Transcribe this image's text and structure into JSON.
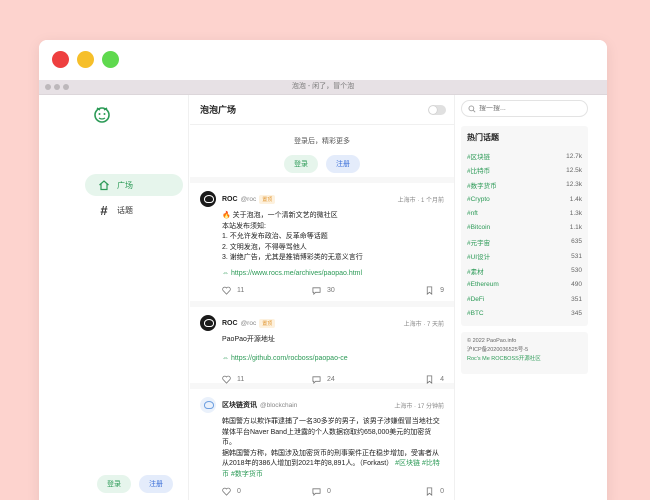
{
  "window": {
    "title": "泡泡 - 闲了，冒个泡"
  },
  "sidebar": {
    "nav": [
      {
        "label": "广场",
        "icon": "home-icon",
        "active": true
      },
      {
        "label": "话题",
        "icon": "hash-icon",
        "active": false
      }
    ],
    "login_label": "登录",
    "register_label": "注册"
  },
  "feed": {
    "title": "泡泡广场",
    "login_hint": "登录后，精彩更多",
    "login_label": "登录",
    "register_label": "注册",
    "posts": [
      {
        "author": "ROC",
        "handle": "@roc",
        "badge": "置顶",
        "meta": "上海市 · 1 个月前",
        "lines": [
          "🔥 关于泡泡，一个清新文艺的微社区",
          "本站发布须知:",
          "1. 不允许发布政治、反革命等话题",
          "2. 文明发泡，不得辱骂他人",
          "3. 谢绝广告，尤其是推销博彩类的无意义言行"
        ],
        "link": "https://www.rocs.me/archives/paopao.html",
        "likes": "11",
        "comments": "30",
        "collects": "9"
      },
      {
        "author": "ROC",
        "handle": "@roc",
        "badge": "置顶",
        "meta": "上海市 · 7 天前",
        "lines": [
          "PaoPao开源地址"
        ],
        "link": "https://github.com/rocboss/paopao-ce",
        "likes": "11",
        "comments": "24",
        "collects": "4"
      },
      {
        "author": "区块链资讯",
        "handle": "@blockchain",
        "badge": "",
        "meta": "上海市 · 17 分钟前",
        "lines": [
          "韩国警方以欺诈罪逮捕了一名30多岁的男子，该男子涉嫌假冒当地社交媒体平台Naver Band上泄露的个人数据窃取约658,000美元的加密货币。",
          "据韩国警方称，韩国涉及加密货币的刑事案件正在稳步增加，受害者从从2018年的386人增加到2021年的8,891人。（Forkast）"
        ],
        "tags": [
          "#区块链",
          "#比特币",
          "#数字货币"
        ],
        "likes": "0",
        "comments": "0",
        "collects": "0"
      }
    ]
  },
  "search": {
    "placeholder": "搜一搜..."
  },
  "trends": {
    "title": "热门话题",
    "items": [
      {
        "name": "#区块链",
        "count": "12.7k"
      },
      {
        "name": "#比特币",
        "count": "12.5k"
      },
      {
        "name": "#数字货币",
        "count": "12.3k"
      },
      {
        "name": "#Crypto",
        "count": "1.4k"
      },
      {
        "name": "#nft",
        "count": "1.3k"
      },
      {
        "name": "#Bitcoin",
        "count": "1.1k"
      },
      {
        "name": "#元宇宙",
        "count": "635"
      },
      {
        "name": "#UI设计",
        "count": "531"
      },
      {
        "name": "#素材",
        "count": "530"
      },
      {
        "name": "#Ethereum",
        "count": "490"
      },
      {
        "name": "#DeFi",
        "count": "351"
      },
      {
        "name": "#BTC",
        "count": "345"
      }
    ]
  },
  "footer": {
    "copyright": "© 2022 PaoPao.info",
    "icp": "沪ICP备2020036525号-5",
    "links": "Roc's Me    ROCBOSS开源社区"
  },
  "colors": {
    "accent": "#2b9a56",
    "background": "#fdd3ce"
  }
}
